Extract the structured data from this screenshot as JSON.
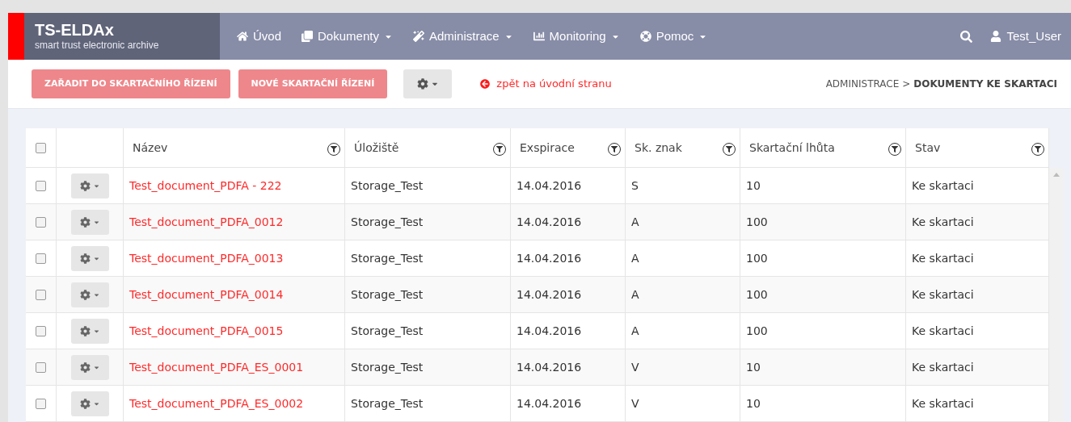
{
  "brand": {
    "title": "TS-ELDAx",
    "subtitle": "smart trust electronic archive"
  },
  "nav": [
    {
      "label": "Úvod",
      "dropdown": false
    },
    {
      "label": "Dokumenty",
      "dropdown": true
    },
    {
      "label": "Administrace",
      "dropdown": true
    },
    {
      "label": "Monitoring",
      "dropdown": true
    },
    {
      "label": "Pomoc",
      "dropdown": true
    }
  ],
  "user": {
    "label": "Test_User"
  },
  "toolbar": {
    "buttons": [
      "ZAŘADIT DO SKARTAČNÍHO ŘÍZENÍ",
      "NOVÉ SKARTAČNÍ ŘÍZENÍ"
    ],
    "back_link": "zpět na úvodní stranu"
  },
  "breadcrumb": {
    "parent": "ADMINISTRACE",
    "separator": ">",
    "current": "DOKUMENTY KE SKARTACI"
  },
  "table": {
    "select_all_checked": false,
    "columns": [
      "Název",
      "Úložiště",
      "Exspirace",
      "Sk. znak",
      "Skartační lhůta",
      "Stav"
    ],
    "rows": [
      {
        "checked": false,
        "cells": [
          "Test_document_PDFA - 222",
          "Storage_Test",
          "14.04.2016",
          "S",
          "10",
          "Ke skartaci"
        ]
      },
      {
        "checked": false,
        "cells": [
          "Test_document_PDFA_0012",
          "Storage_Test",
          "14.04.2016",
          "A",
          "100",
          "Ke skartaci"
        ]
      },
      {
        "checked": false,
        "cells": [
          "Test_document_PDFA_0013",
          "Storage_Test",
          "14.04.2016",
          "A",
          "100",
          "Ke skartaci"
        ]
      },
      {
        "checked": false,
        "cells": [
          "Test_document_PDFA_0014",
          "Storage_Test",
          "14.04.2016",
          "A",
          "100",
          "Ke skartaci"
        ]
      },
      {
        "checked": false,
        "cells": [
          "Test_document_PDFA_0015",
          "Storage_Test",
          "14.04.2016",
          "A",
          "100",
          "Ke skartaci"
        ]
      },
      {
        "checked": false,
        "cells": [
          "Test_document_PDFA_ES_0001",
          "Storage_Test",
          "14.04.2016",
          "V",
          "10",
          "Ke skartaci"
        ]
      },
      {
        "checked": false,
        "cells": [
          "Test_document_PDFA_ES_0002",
          "Storage_Test",
          "14.04.2016",
          "V",
          "10",
          "Ke skartaci"
        ]
      }
    ]
  }
}
